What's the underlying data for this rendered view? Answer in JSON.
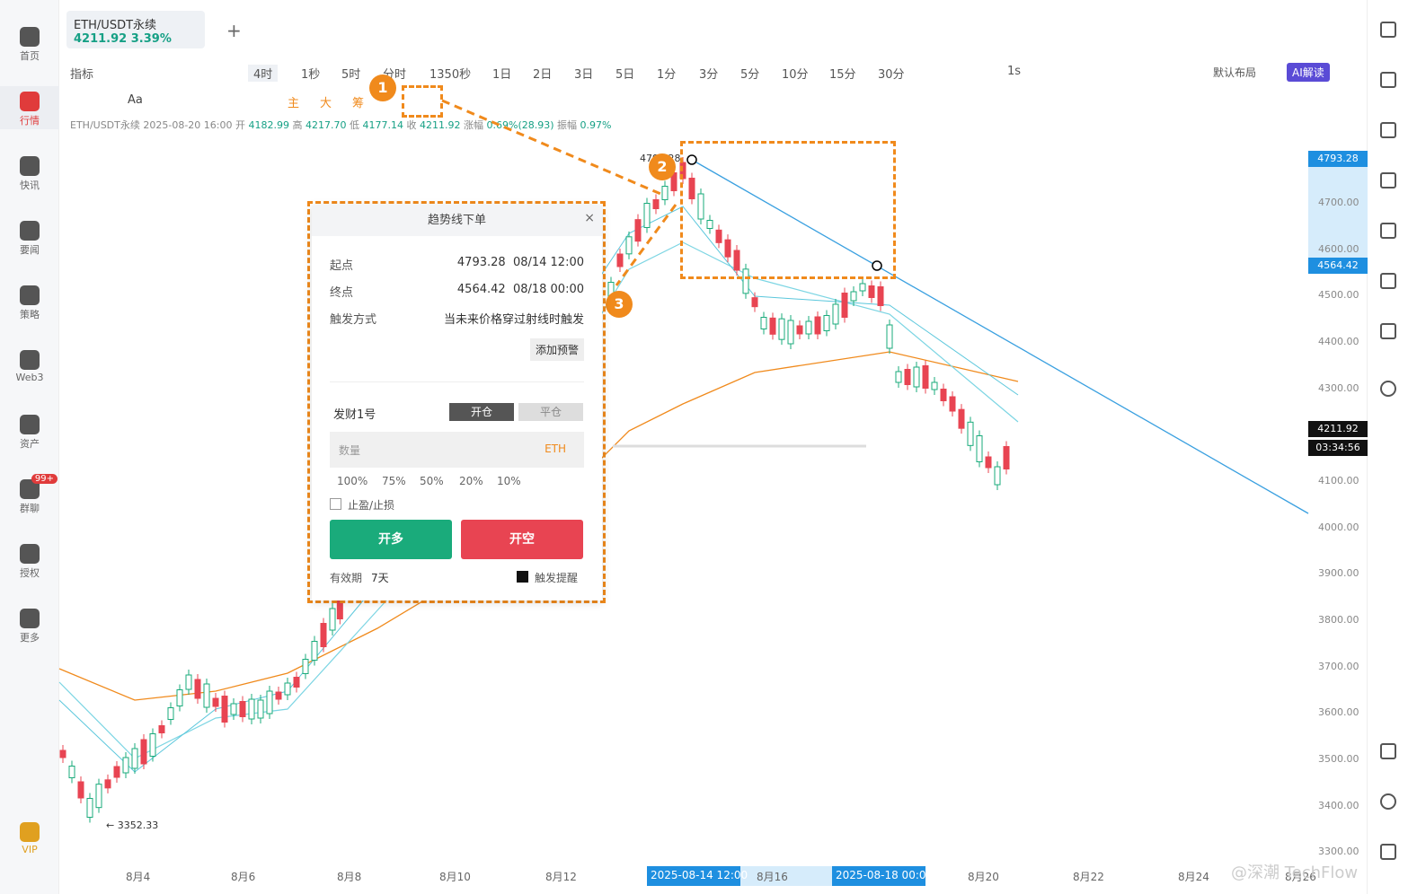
{
  "tab": {
    "symbol": "ETH/USDT永续",
    "price": "4211.92",
    "change": "3.39%"
  },
  "sidebar": [
    {
      "label": "首页",
      "icon": "home-icon"
    },
    {
      "label": "行情",
      "icon": "chart-icon",
      "active": true
    },
    {
      "label": "快讯",
      "icon": "news-icon"
    },
    {
      "label": "要闻",
      "icon": "article-icon"
    },
    {
      "label": "策略",
      "icon": "robot-icon"
    },
    {
      "label": "Web3",
      "icon": "web3-icon"
    },
    {
      "label": "资产",
      "icon": "wallet-icon"
    },
    {
      "label": "群聊",
      "icon": "chat-icon",
      "badge": "99+"
    },
    {
      "label": "授权",
      "icon": "key-icon"
    },
    {
      "label": "更多",
      "icon": "grid-icon"
    },
    {
      "label": "VIP",
      "icon": "vip-icon"
    }
  ],
  "toolbar": {
    "indicator": "指标",
    "interval": "4时",
    "times": [
      "1秒",
      "5时",
      "分时",
      "1350秒",
      "1日",
      "2日",
      "3日",
      "5日",
      "1分",
      "3分",
      "5分",
      "10分",
      "15分",
      "30分"
    ],
    "right_interval": "1s",
    "layout": "默认布局",
    "ai": "AI解读"
  },
  "toolbar2": {
    "text_tool": "Aa",
    "main": "主",
    "big": "大",
    "chip": "筹"
  },
  "info": {
    "symbol": "ETH/USDT永续",
    "datetime": "2025-08-20 16:00",
    "open_label": "开",
    "open": "4182.99",
    "high_label": "高",
    "high": "4217.70",
    "low_label": "低",
    "low": "4177.14",
    "close_label": "收",
    "close": "4211.92",
    "change_label": "涨幅",
    "change": "0.69%(28.93)",
    "amp_label": "振幅",
    "amp": "0.97%"
  },
  "panel": {
    "title": "趋势线下单",
    "start_label": "起点",
    "start_value": "4793.28",
    "start_time": "08/14 12:00",
    "end_label": "终点",
    "end_value": "4564.42",
    "end_time": "08/18 00:00",
    "trigger_label": "触发方式",
    "trigger_value": "当未来价格穿过射线时触发",
    "alert_btn": "添加预警",
    "account": "发财1号",
    "open_tab": "开仓",
    "close_tab": "平仓",
    "qty_placeholder": "数量",
    "qty_unit": "ETH",
    "pcts": [
      "100%",
      "75%",
      "50%",
      "20%",
      "10%"
    ],
    "tpsl": "止盈/止损",
    "long": "开多",
    "short": "开空",
    "validity_label": "有效期",
    "validity": "7天",
    "trigger_alert": "触发提醒"
  },
  "colors": {
    "long": "#1aab7b",
    "short": "#e84452",
    "accent": "#f08a1c",
    "trend": "#3aa0e0"
  },
  "yaxis": [
    "4700.00",
    "4600.00",
    "4500.00",
    "4400.00",
    "4300.00",
    "4100.00",
    "4000.00",
    "3900.00",
    "3800.00",
    "3700.00",
    "3600.00",
    "3500.00",
    "3400.00",
    "3300.00"
  ],
  "ylabels": {
    "top": "4793.28",
    "mid": "4564.42",
    "last": "4211.92",
    "timer": "03:34:56"
  },
  "xaxis": [
    "8月4",
    "8月6",
    "8月8",
    "8月10",
    "8月12",
    "8月16",
    "8月20",
    "8月22",
    "8月24",
    "8月26"
  ],
  "xhl": {
    "start": "2025-08-14 12:00",
    "end": "2025-08-18 00:00"
  },
  "low_label": "← 3352.33",
  "high_label": "4793.28",
  "markers": [
    "1",
    "2",
    "3"
  ],
  "watermark": "@深潮 TechFlow"
}
